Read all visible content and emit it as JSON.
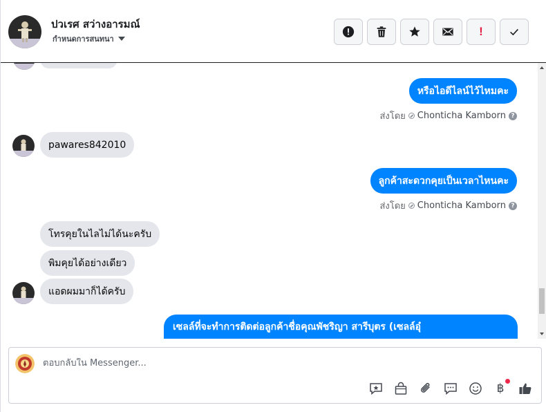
{
  "header": {
    "name": "ปวเรศ สว่างอารมณ์",
    "subtitle": "กำหนดการสนทนา",
    "actions": [
      {
        "name": "spam-button",
        "icon": "alert-circle-icon"
      },
      {
        "name": "delete-button",
        "icon": "trash-icon"
      },
      {
        "name": "star-button",
        "icon": "star-icon"
      },
      {
        "name": "mark-unread-button",
        "icon": "envelope-icon"
      },
      {
        "name": "follow-up-button",
        "icon": "exclamation-icon",
        "label": "!"
      },
      {
        "name": "done-button",
        "icon": "check-icon"
      }
    ]
  },
  "messages": {
    "out_1": "หรือไอดีไลน์ไว้ไหมคะ",
    "sent_by_1": {
      "prefix": "ส่งโดย",
      "name": "Chonticha Kamborn"
    },
    "in_1": "pawares842010",
    "out_2": "ลูกค้าสะดวกคุยเป็นเวลาไหนคะ",
    "sent_by_2": {
      "prefix": "ส่งโดย",
      "name": "Chonticha Kamborn"
    },
    "in_2": "โทรคุยในไลไม่ได้นะครับ",
    "in_3": "พิมคุยได้อย่างเดียว",
    "in_4": "แอดผมมาก็ได้ครับ",
    "out_3": "เซลล์ที่จะทำการติดต่อลูกค้าชื่อคุณพัชริญา สารีบุตร (เซลล์อุ๋"
  },
  "composer": {
    "placeholder": "ตอบกลับใน Messenger...",
    "tools": [
      "saved-reply-icon",
      "shop-bag-icon",
      "attachment-icon",
      "chat-bubble-icon",
      "emoji-icon",
      "baht-icon",
      "like-icon"
    ],
    "baht_symbol": "฿"
  },
  "colors": {
    "accent": "#0084ff",
    "incoming_bubble": "#e4e6eb",
    "follow_up": "#e41e3f"
  }
}
